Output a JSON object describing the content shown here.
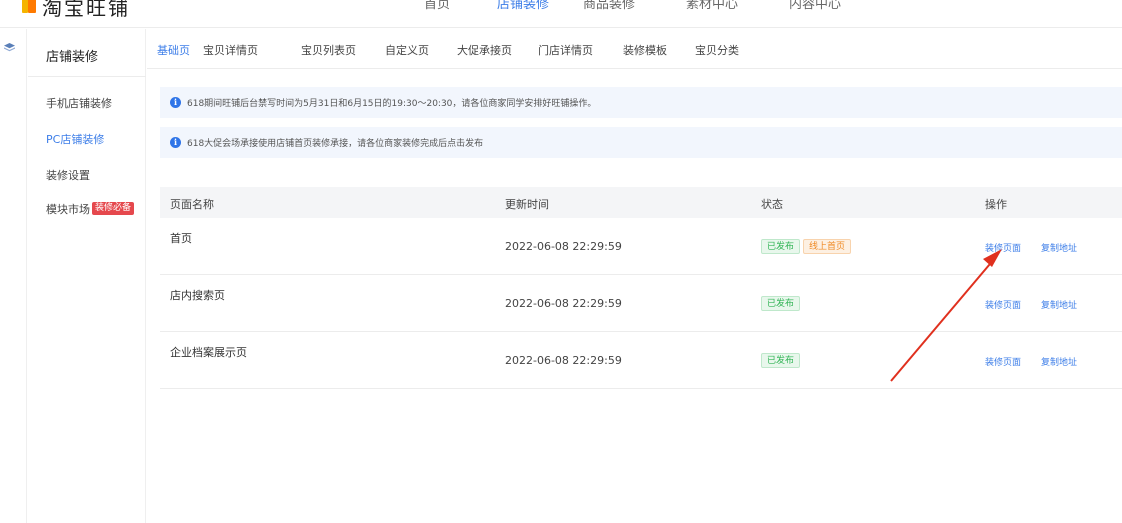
{
  "brand": {
    "name": "淘宝旺铺"
  },
  "topnav": [
    "首页",
    "店铺装修",
    "商品装修",
    "素材中心",
    "内容中心"
  ],
  "topnav_active": "店铺装修",
  "sidemenu": {
    "title": "店铺装修",
    "items": [
      "手机店铺装修",
      "PC店铺装修",
      "装修设置",
      "模块市场"
    ],
    "active": "PC店铺装修",
    "badge": "装修必备"
  },
  "subtabs": [
    "基础页",
    "宝贝详情页",
    "宝贝列表页",
    "自定义页",
    "大促承接页",
    "门店详情页",
    "装修模板",
    "宝贝分类"
  ],
  "subtab_active": "基础页",
  "notices": [
    "618期间旺铺后台禁写时间为5月31日和6月15日的19:30～20:30，请各位商家同学安排好旺铺操作。",
    "618大促会场承接使用店铺首页装修承接，请各位商家装修完成后点击发布"
  ],
  "table": {
    "headers": [
      "页面名称",
      "更新时间",
      "状态",
      "操作"
    ],
    "rows": [
      {
        "name": "首页",
        "time": "2022-06-08 22:29:59",
        "status": "已发布",
        "extra_tag": "线上首页",
        "actions": [
          "装修页面",
          "复制地址"
        ]
      },
      {
        "name": "店内搜索页",
        "time": "2022-06-08 22:29:59",
        "status": "已发布",
        "actions": [
          "装修页面",
          "复制地址"
        ]
      },
      {
        "name": "企业档案展示页",
        "time": "2022-06-08 22:29:59",
        "status": "已发布",
        "actions": [
          "装修页面",
          "复制地址"
        ]
      }
    ]
  },
  "colors": {
    "accent": "#3d7ee8",
    "published": "#31b455",
    "online_home": "#f08a24",
    "arrow": "#e0301e",
    "badge": "#e5484d"
  }
}
